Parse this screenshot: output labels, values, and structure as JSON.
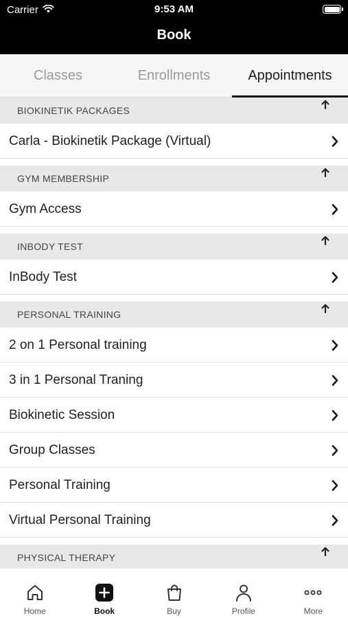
{
  "status_bar": {
    "carrier": "Carrier",
    "time": "9:53 AM"
  },
  "nav": {
    "title": "Book"
  },
  "tabs": [
    {
      "label": "Classes",
      "active": false
    },
    {
      "label": "Enrollments",
      "active": false
    },
    {
      "label": "Appointments",
      "active": true
    }
  ],
  "sections": [
    {
      "title": "BIOKINETIK PACKAGES",
      "items": [
        "Carla - Biokinetik Package (Virtual)"
      ]
    },
    {
      "title": "GYM MEMBERSHIP",
      "items": [
        "Gym Access"
      ]
    },
    {
      "title": "INBODY TEST",
      "items": [
        "InBody Test"
      ]
    },
    {
      "title": "PERSONAL TRAINING",
      "items": [
        "2 on 1 Personal training",
        "3 in 1 Personal Traning",
        "Biokinetic Session",
        "Group Classes",
        "Personal Training",
        "Virtual Personal Training"
      ]
    },
    {
      "title": "PHYSICAL THERAPY",
      "items": []
    }
  ],
  "tab_bar": [
    {
      "label": "Home",
      "icon": "home-icon",
      "active": false
    },
    {
      "label": "Book",
      "icon": "book-plus-icon",
      "active": true
    },
    {
      "label": "Buy",
      "icon": "shopping-bag-icon",
      "active": false
    },
    {
      "label": "Profile",
      "icon": "profile-icon",
      "active": false
    },
    {
      "label": "More",
      "icon": "more-dots-icon",
      "active": false
    }
  ],
  "colors": {
    "header_bg": "#000000",
    "section_bg": "#e8e8e8",
    "tab_bg": "#f6f6f6",
    "accent": "#111111"
  }
}
